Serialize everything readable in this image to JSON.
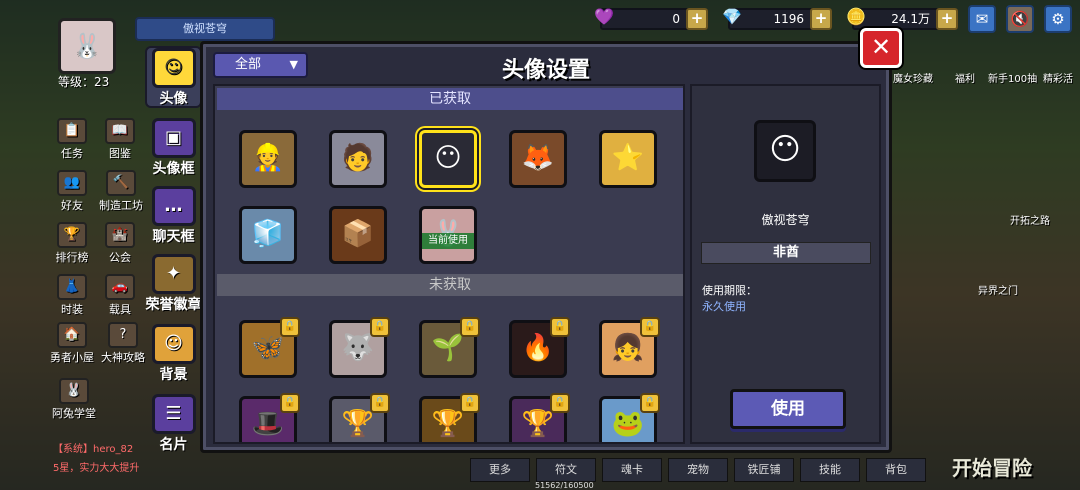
{
  "top": {
    "player_name": "傲视苍穹",
    "gems": "0",
    "diamonds": "1196",
    "gold": "24.1万",
    "level": "等级：23"
  },
  "left_hud": [
    "任务",
    "图鉴",
    "好友",
    "制造工坊",
    "排行榜",
    "公会",
    "时装",
    "载具",
    "勇者小屋",
    "大神攻略",
    "阿兔学堂"
  ],
  "chat": {
    "line1": "【系统】hero_82",
    "line2": "5星，实力大大提升"
  },
  "tabs": [
    "头像",
    "头像框",
    "聊天框",
    "荣誉徽章",
    "背景",
    "名片"
  ],
  "panel": {
    "title": "头像设置",
    "filter": "全部",
    "section_owned": "已获取",
    "section_locked": "未获取",
    "current_badge": "当前使用"
  },
  "detail": {
    "name": "傲视苍穹",
    "rarity": "非酋",
    "period_label": "使用期限：",
    "period_value": "永久使用",
    "use_button": "使用"
  },
  "right_hud": {
    "shop": "魔女珍藏",
    "welfare": "福利",
    "newbie": "新手100抽",
    "activity": "精彩活",
    "road": "开拓之路",
    "portal": "异界之门",
    "start": "开始冒险"
  },
  "bottom_bar": [
    "更多",
    "符文",
    "魂卡",
    "宠物",
    "铁匠铺",
    "技能",
    "背包"
  ],
  "xp": "51562/160500",
  "colors": {
    "accent": "#5c5ab5",
    "select": "#ffe21a",
    "close": "#d6252b"
  }
}
